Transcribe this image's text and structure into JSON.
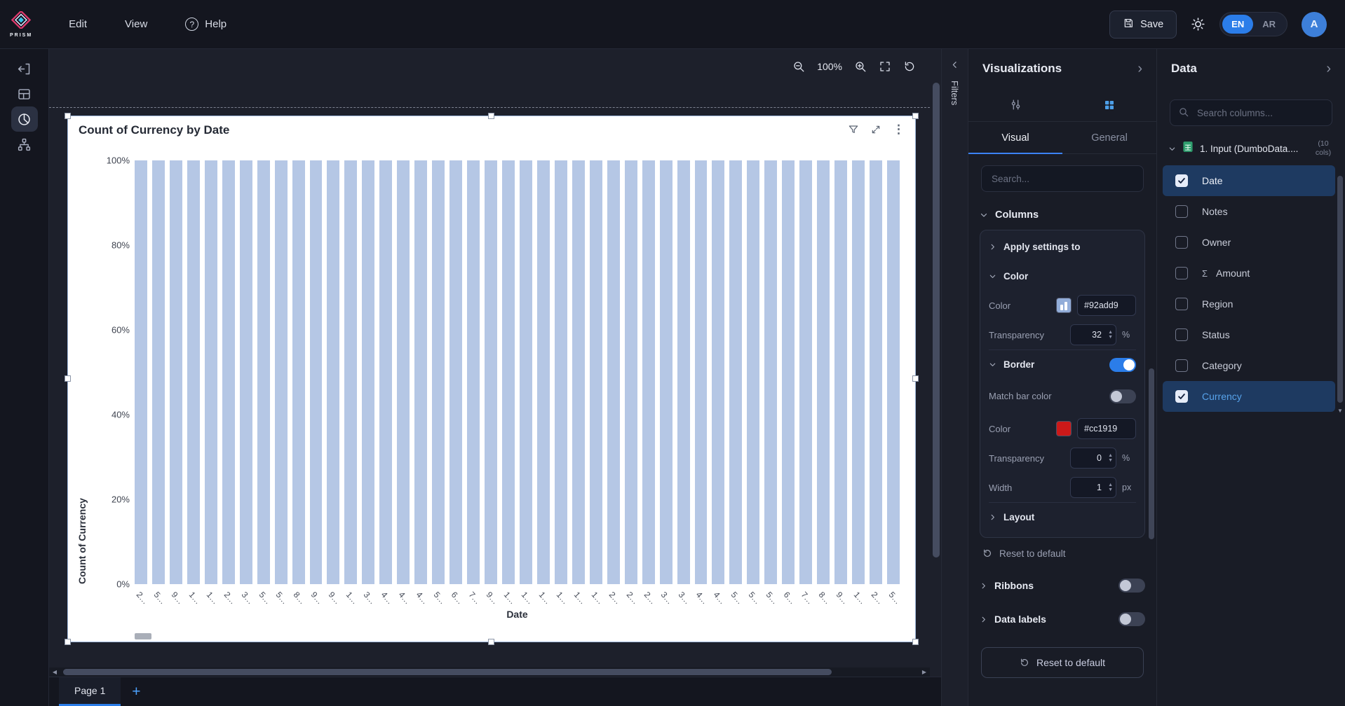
{
  "topbar": {
    "logo_text": "PRISM",
    "menus": [
      {
        "label": "Edit"
      },
      {
        "label": "View"
      },
      {
        "label": "Help"
      }
    ],
    "save_label": "Save",
    "lang_en": "EN",
    "lang_ar": "AR",
    "avatar_initial": "A"
  },
  "canvas": {
    "zoom_level": "100%",
    "filters_label": "Filters",
    "page_tab": "Page 1",
    "add_page_label": "+"
  },
  "chart_data": {
    "type": "bar",
    "title": "Count of Currency by Date",
    "xlabel": "Date",
    "ylabel": "Count of Currency",
    "stacked_percent": true,
    "ylim": [
      0,
      100
    ],
    "yticks": [
      "100%",
      "80%",
      "60%",
      "40%",
      "20%",
      "0%"
    ],
    "x": [
      "2…",
      "5…",
      "9…",
      "1…",
      "1…",
      "2…",
      "3…",
      "5…",
      "5…",
      "8…",
      "9…",
      "9…",
      "1…",
      "3…",
      "4…",
      "4…",
      "4…",
      "5…",
      "6…",
      "7…",
      "9…",
      "1…",
      "1…",
      "1…",
      "1…",
      "1…",
      "1…",
      "2…",
      "2…",
      "2…",
      "3…",
      "3…",
      "4…",
      "4…",
      "5…",
      "5…",
      "5…",
      "6…",
      "7…",
      "8…",
      "9…",
      "1…",
      "2…",
      "5…"
    ],
    "values": [
      100,
      100,
      100,
      100,
      100,
      100,
      100,
      100,
      100,
      100,
      100,
      100,
      100,
      100,
      100,
      100,
      100,
      100,
      100,
      100,
      100,
      100,
      100,
      100,
      100,
      100,
      100,
      100,
      100,
      100,
      100,
      100,
      100,
      100,
      100,
      100,
      100,
      100,
      100,
      100,
      100,
      100,
      100,
      100
    ],
    "legend": [],
    "grid": false
  },
  "visualizations": {
    "title": "Visualizations",
    "tabs": {
      "visual": "Visual",
      "general": "General"
    },
    "search_placeholder": "Search...",
    "sections": {
      "columns_label": "Columns",
      "apply_settings_label": "Apply settings to",
      "color_section": "Color",
      "color_label": "Color",
      "color_value": "#92add9",
      "transparency_label": "Transparency",
      "transparency_value": "32",
      "percent_suffix": "%",
      "border_section": "Border",
      "match_bar_color_label": "Match bar color",
      "border_color_label": "Color",
      "border_color_value": "#cc1919",
      "border_transparency_label": "Transparency",
      "border_transparency_value": "0",
      "width_label": "Width",
      "width_value": "1",
      "px_suffix": "px",
      "layout_label": "Layout",
      "reset_link": "Reset to default",
      "ribbons_label": "Ribbons",
      "data_labels_label": "Data labels",
      "reset_button": "Reset to default"
    }
  },
  "data_panel": {
    "title": "Data",
    "search_placeholder": "Search columns...",
    "source": {
      "name": "1. Input (DumboData....",
      "cols_badge": "(10 cols)"
    },
    "fields": [
      {
        "label": "Date",
        "checked": true,
        "selected": true,
        "accent": false,
        "sigma": false
      },
      {
        "label": "Notes",
        "checked": false,
        "selected": false,
        "accent": false,
        "sigma": false
      },
      {
        "label": "Owner",
        "checked": false,
        "selected": false,
        "accent": false,
        "sigma": false
      },
      {
        "label": "Amount",
        "checked": false,
        "selected": false,
        "accent": false,
        "sigma": true
      },
      {
        "label": "Region",
        "checked": false,
        "selected": false,
        "accent": false,
        "sigma": false
      },
      {
        "label": "Status",
        "checked": false,
        "selected": false,
        "accent": false,
        "sigma": false
      },
      {
        "label": "Category",
        "checked": false,
        "selected": false,
        "accent": false,
        "sigma": false
      },
      {
        "label": "Currency",
        "checked": true,
        "selected": true,
        "accent": true,
        "sigma": false
      }
    ]
  },
  "colors": {
    "accent": "#2b7de9",
    "bar_fill": "#92add9",
    "bar_fill_rendered": "#b5c7e5",
    "bar_border": "#cc1919",
    "selected_row": "#1e3a61"
  }
}
